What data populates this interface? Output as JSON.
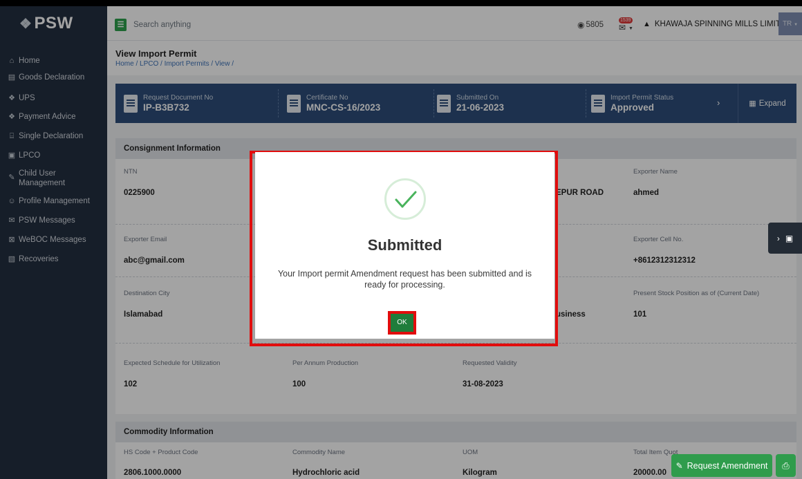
{
  "app": {
    "logo": "PSW"
  },
  "sidebar": {
    "items": [
      {
        "label": "Home",
        "icon": "home-icon"
      },
      {
        "label": "Goods Declaration",
        "icon": "document-icon"
      },
      {
        "label": "UPS",
        "icon": "diamond-icon"
      },
      {
        "label": "Payment Advice",
        "icon": "diamond-icon"
      },
      {
        "label": "Single Declaration",
        "icon": "building-icon"
      },
      {
        "label": "LPCO",
        "icon": "file-icon"
      },
      {
        "label": "Child User Management",
        "icon": "user-edit-icon"
      },
      {
        "label": "Profile Management",
        "icon": "profile-icon"
      },
      {
        "label": "PSW Messages",
        "icon": "messages-icon"
      },
      {
        "label": "WeBOC Messages",
        "icon": "mail-icon"
      },
      {
        "label": "Recoveries",
        "icon": "recoveries-icon"
      }
    ]
  },
  "topbar": {
    "search_placeholder": "Search anything",
    "coins": "5805",
    "notif_count": "1539",
    "company": "KHAWAJA SPINNING MILLS LIMITED",
    "user_initials": "TR"
  },
  "page": {
    "title": "View Import Permit",
    "breadcrumb": "Home / LPCO / Import Permits / View /"
  },
  "summary": {
    "request_doc_label": "Request Document No",
    "request_doc_value": "IP-B3B732",
    "certificate_label": "Certificate No",
    "certificate_value": "MNC-CS-16/2023",
    "submitted_label": "Submitted On",
    "submitted_value": "21-06-2023",
    "status_label": "Import Permit Status",
    "status_value": "Approved",
    "expand_label": "Expand"
  },
  "consignment": {
    "heading": "Consignment Information",
    "ntn_label": "NTN",
    "ntn_value": "0225900",
    "address_partial": "EPUR ROAD",
    "exporter_name_label": "Exporter Name",
    "exporter_name_value": "ahmed",
    "exporter_email_label": "Exporter Email",
    "exporter_email_value": "abc@gmail.com",
    "exporter_cell_label": "Exporter Cell No.",
    "exporter_cell_value": "+8612312312312",
    "dest_city_label": "Destination City",
    "dest_city_value": "Islamabad",
    "business_partial": "usiness",
    "stock_label": "Present Stock Position as of (Current Date)",
    "stock_value": "101",
    "schedule_label": "Expected Schedule for Utilization",
    "schedule_value": "102",
    "production_label": "Per Annum Production",
    "production_value": "100",
    "validity_label": "Requested Validity",
    "validity_value": "31-08-2023"
  },
  "commodity": {
    "heading": "Commodity Information",
    "col1": "HS Code + Product Code",
    "col2": "Commodity Name",
    "col3": "UOM",
    "col4": "Total Item Quot",
    "val1": "2806.1000.0000",
    "val2": "Hydrochloric acid",
    "val3": "Kilogram",
    "val4": "20000.00"
  },
  "modal": {
    "title": "Submitted",
    "message": "Your Import permit Amendment request has been submitted and is ready for processing.",
    "ok_label": "OK"
  },
  "actions": {
    "request_amendment": "Request Amendment"
  },
  "colors": {
    "sidebar_bg": "#232f40",
    "summary_bg": "#2e4e7a",
    "primary_green": "#2f9c4c",
    "highlight_red": "#e10d0d"
  }
}
